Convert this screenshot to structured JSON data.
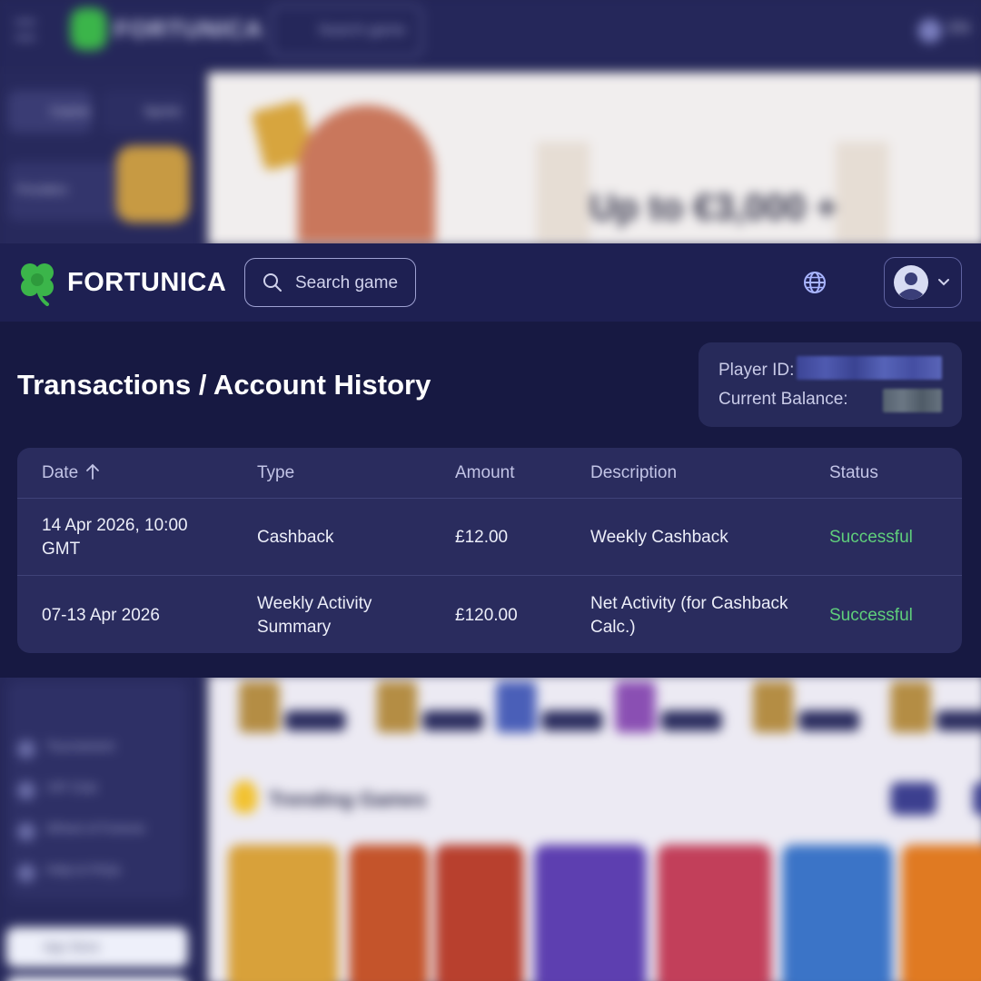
{
  "background": {
    "brand": "FORTUNICA",
    "search_placeholder": "Search game",
    "lang": "EN",
    "tab_casino": "Casino",
    "tab_sports": "Sports",
    "promo_label": "Providers",
    "hero_text": "Up to €3,000 +",
    "sidebar_links": [
      "Tournament",
      "VIP Club",
      "Wheel of Fortune",
      "Help & FAQs"
    ],
    "app_button": "App Store",
    "section_title": "Trending Games",
    "game_colors": [
      "#d8a13a",
      "#c4542b",
      "#b8402e",
      "#5d3fb0",
      "#c23f5a",
      "#3b74c7",
      "#e07a22"
    ]
  },
  "header": {
    "brand": "FORTUNICA",
    "search_placeholder": "Search game"
  },
  "page": {
    "title": "Transactions / Account History",
    "player_id_label": "Player ID:",
    "balance_label": "Current Balance:"
  },
  "table": {
    "columns": [
      "Date",
      "Type",
      "Amount",
      "Description",
      "Status"
    ],
    "rows": [
      {
        "date": "14 Apr 2026, 10:00 GMT",
        "type": "Cashback",
        "amount": "£12.00",
        "description": "Weekly Cashback",
        "status": "Successful"
      },
      {
        "date": "07-13 Apr 2026",
        "type": "Weekly Activity Summary",
        "amount": "£120.00",
        "description": "Net Activity (for Cashback Calc.)",
        "status": "Successful"
      }
    ]
  },
  "colors": {
    "accent_green": "#3bb54a",
    "status_success": "#5fcf7b",
    "overlay_bg": "#171942",
    "table_bg": "#2a2c5e"
  }
}
